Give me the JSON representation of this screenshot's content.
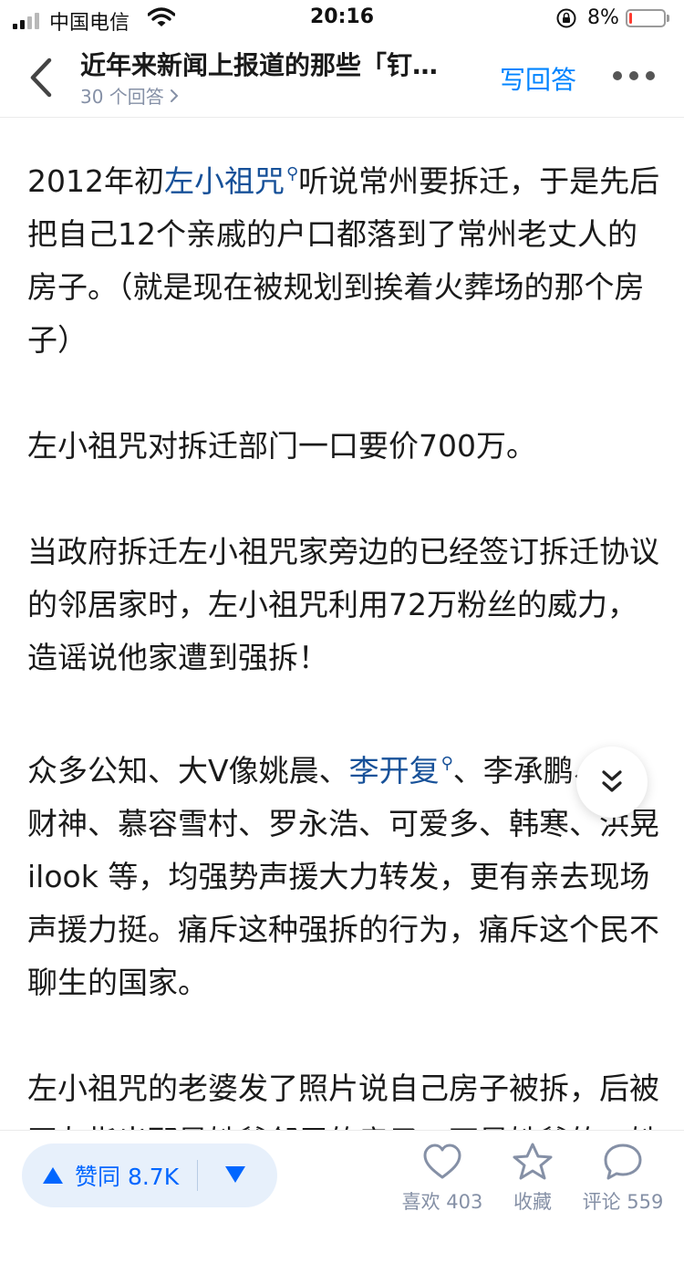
{
  "status_bar": {
    "carrier": "中国电信",
    "time": "20:16",
    "battery_percent": "8%",
    "battery_level": 0.08,
    "signal_bars": 4,
    "signal_bars_active": 2,
    "battery_color": "#ff3b30"
  },
  "nav": {
    "title": "近年来新闻上报道的那些「钉…",
    "answer_count": "30 个回答",
    "write_answer": "写回答",
    "accent_color": "#0084ff"
  },
  "content": {
    "mention_color": "#175199",
    "paragraphs": [
      {
        "pre": "2012年初",
        "mention": "左小祖咒",
        "post": "听说常州要拆迁，于是先后把自己12个亲戚的户口都落到了常州老丈人的房子。（就是现在被规划到挨着火葬场的那个房子）"
      },
      {
        "text": "左小祖咒对拆迁部门一口要价700万。"
      },
      {
        "text": "当政府拆迁左小祖咒家旁边的已经签订拆迁协议的邻居家时，左小祖咒利用72万粉丝的威力，造谣说他家遭到强拆！"
      },
      {
        "pre": "众多公知、大V像姚晨、",
        "mention": "李开复",
        "post": "、李承鹏、宁财神、慕容雪村、罗永浩、可爱多、韩寒、洪晃ilook 等，均强势声援大力转发，更有亲去现场声援力挺。痛斥这种强拆的行为，痛斥这个民不聊生的国家。"
      },
      {
        "text": "左小祖咒的老婆发了照片说自己房子被拆，后被网友指出那是她爹邻居的房子，不是她爹的，她爹的房子完好。（见上图）"
      }
    ]
  },
  "bottom_bar": {
    "upvote_label": "赞同 8.7K",
    "like_label": "喜欢 403",
    "favorite_label": "收藏",
    "comment_label": "评论 559",
    "vote_color": "#0066ff"
  },
  "icons": {
    "back": "chevron-left-icon",
    "more": "more-dots-icon",
    "expand": "double-chevron-down-icon",
    "like": "heart-icon",
    "favorite": "star-icon",
    "comment": "speech-bubble-icon"
  }
}
